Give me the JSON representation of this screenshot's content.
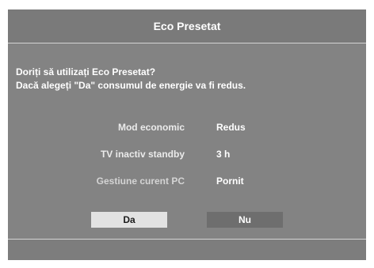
{
  "dialog": {
    "title": "Eco Presetat",
    "question_line1": "Doriți să utilizați Eco Presetat?",
    "question_line2": "Dacă alegeți \"Da\" consumul de energie va fi redus.",
    "settings": [
      {
        "label": "Mod economic",
        "value": "Redus"
      },
      {
        "label": "TV inactiv standby",
        "value": "3 h"
      },
      {
        "label": "Gestiune curent PC",
        "value": "Pornit"
      }
    ],
    "yes_label": "Da",
    "no_label": "Nu"
  },
  "colors": {
    "panel": "#838383",
    "title_bar": "#7a7a7a",
    "selected_button": "#e2e2e2",
    "unselected_button": "#6e6e6e",
    "text": "#ffffff"
  }
}
